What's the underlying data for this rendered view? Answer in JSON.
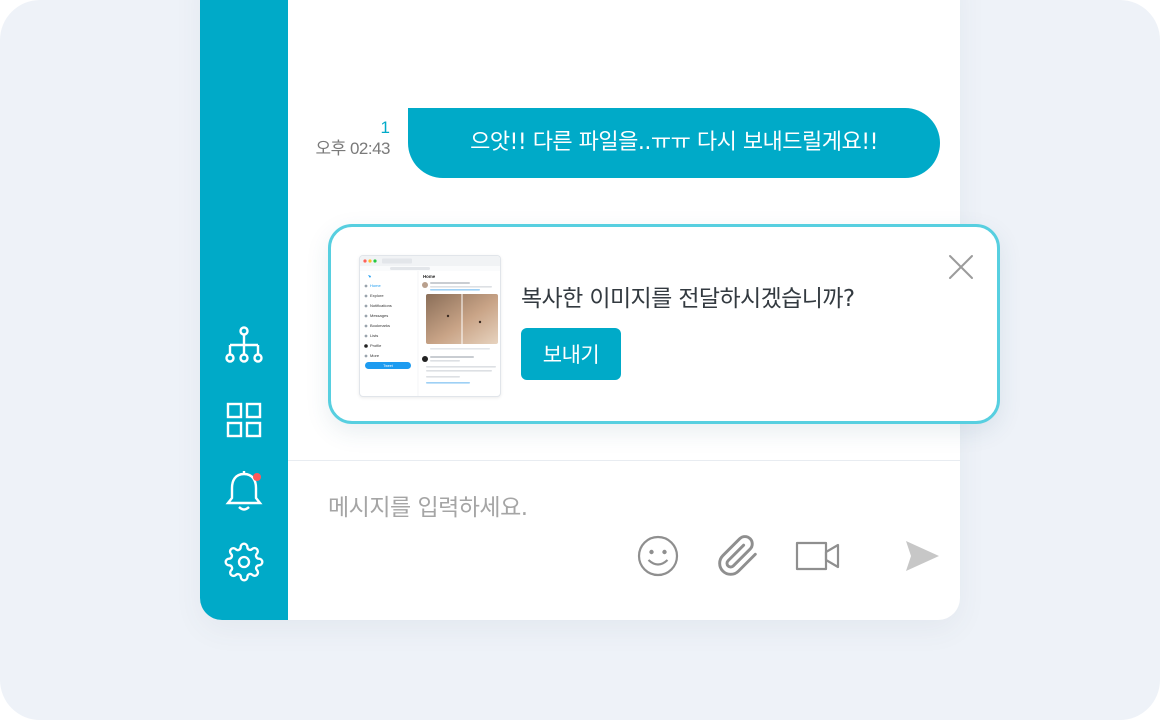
{
  "colors": {
    "accent": "#00aac8",
    "popup_border": "#57cfe0",
    "notification_dot": "#ff5a5a"
  },
  "sidebar": {
    "items": [
      {
        "icon": "org-chart-icon"
      },
      {
        "icon": "grid-icon"
      },
      {
        "icon": "bell-icon",
        "has_notification": true
      },
      {
        "icon": "gear-icon"
      }
    ]
  },
  "message": {
    "read_count": "1",
    "time": "오후 02:43",
    "text": "으앗!! 다른 파일을..ㅠㅠ 다시 보내드릴게요!!"
  },
  "paste_popup": {
    "question": "복사한 이미지를 전달하시겠습니까?",
    "send_label": "보내기",
    "thumbnail": {
      "nav_title": "Home",
      "nav_items": [
        "Home",
        "Explore",
        "Notifications",
        "Messages",
        "Bookmarks",
        "Lists",
        "Profile",
        "More"
      ],
      "tweet_button": "Tweet"
    }
  },
  "composer": {
    "placeholder": "메시지를 입력하세요.",
    "tools": [
      "emoji-icon",
      "paperclip-icon",
      "video-camera-icon",
      "send-icon"
    ]
  }
}
